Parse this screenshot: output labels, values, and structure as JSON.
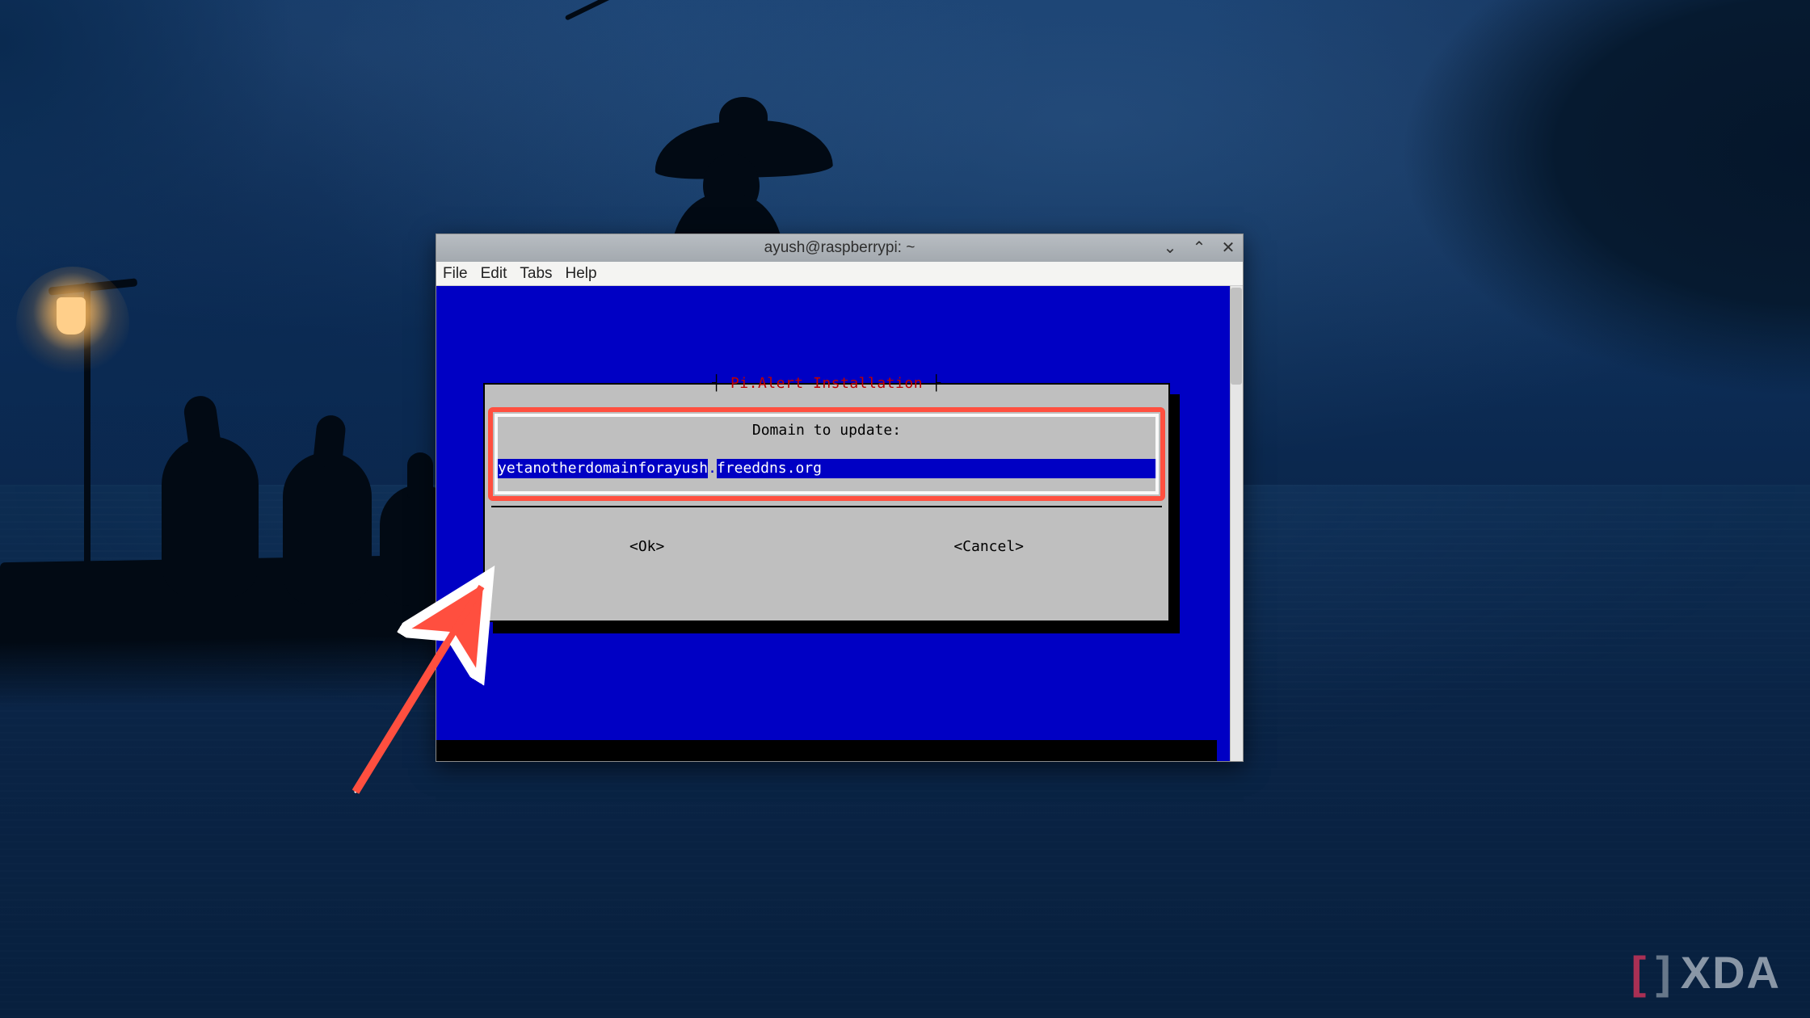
{
  "wallpaper": {
    "description": "Dark blue lake at dusk with silhouetted fisherman in conical hat holding pole, cormorant birds on a raft, glowing lantern on left"
  },
  "window": {
    "title": "ayush@raspberrypi: ~",
    "controls": {
      "minimize": "⌄",
      "maximize": "⌃",
      "close": "✕"
    }
  },
  "menubar": {
    "items": [
      "File",
      "Edit",
      "Tabs",
      "Help"
    ]
  },
  "dialog": {
    "title_left_frame": "┤ ",
    "title": "Pi.Alert Installation",
    "title_right_frame": " ├",
    "prompt": "Domain to update:",
    "input_value_part1": "yetanotherdomainforayush",
    "input_value_sep": ".",
    "input_value_part2": "freeddns.org",
    "buttons": {
      "ok": "<Ok>",
      "cancel": "<Cancel>"
    }
  },
  "annotation": {
    "arrow_color": "#ff4f3f"
  },
  "watermark": {
    "text": "XDA"
  }
}
